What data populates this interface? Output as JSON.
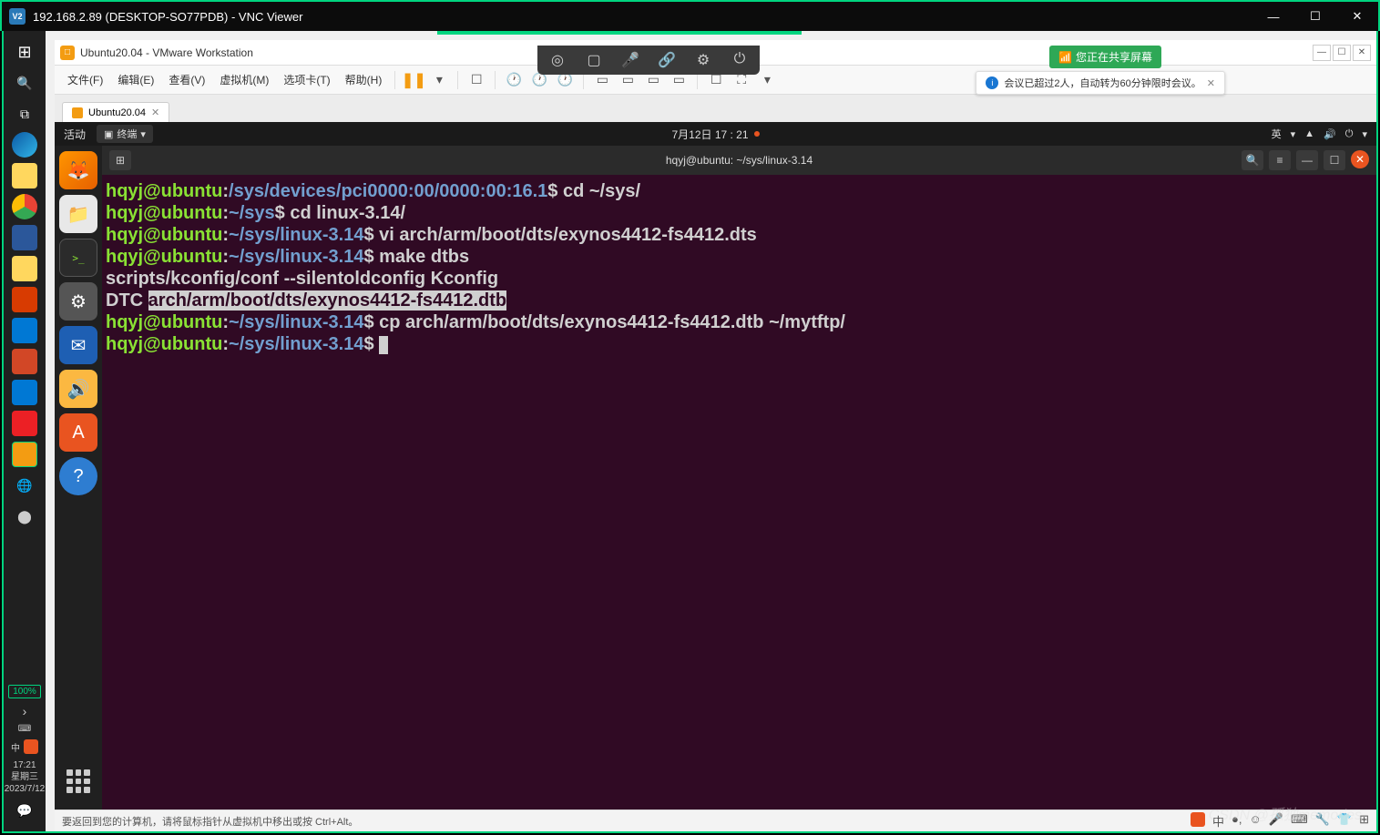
{
  "vnc": {
    "title": "192.168.2.89 (DESKTOP-SO77PDB) - VNC Viewer",
    "icon_text": "V2"
  },
  "win_taskbar": {
    "battery": "100%",
    "time": "17:21",
    "weekday": "星期三",
    "date": "2023/7/12",
    "ime_label": "中",
    "start_icon": "⊞"
  },
  "vmware": {
    "title": "Ubuntu20.04 - VMware Workstation",
    "menu": {
      "file": "文件(F)",
      "edit": "编辑(E)",
      "view": "查看(V)",
      "vm": "虚拟机(M)",
      "tabs": "选项卡(T)",
      "help": "帮助(H)"
    },
    "tab": {
      "label": "Ubuntu20.04"
    },
    "status_text": "要返回到您的计算机，请将鼠标指针从虚拟机中移出或按 Ctrl+Alt。",
    "ime_cn": "中"
  },
  "share": {
    "text": "您正在共享屏幕"
  },
  "notification": {
    "text": "会议已超过2人，自动转为60分钟限时会议。"
  },
  "ubuntu": {
    "activities": "活动",
    "app_label": "终端",
    "datetime": "7月12日  17 : 21",
    "lang": "英"
  },
  "terminal": {
    "title": "hqyj@ubuntu: ~/sys/linux-3.14",
    "lines": [
      {
        "user": "hqyj@ubuntu",
        "path": "/sys/devices/pci0000:00/0000:00:16.1",
        "cmd": "cd ~/sys/"
      },
      {
        "user": "hqyj@ubuntu",
        "path": "~/sys",
        "cmd": "cd linux-3.14/"
      },
      {
        "user": "hqyj@ubuntu",
        "path": "~/sys/linux-3.14",
        "cmd": "vi arch/arm/boot/dts/exynos4412-fs4412.dts"
      },
      {
        "user": "hqyj@ubuntu",
        "path": "~/sys/linux-3.14",
        "cmd": "make dtbs"
      }
    ],
    "output1": "scripts/kconfig/conf --silentoldconfig Kconfig",
    "dtc": "  DTC     ",
    "dtc_hl": "arch/arm/boot/dts/exynos4412-fs4412.dtb",
    "line_cp": {
      "user": "hqyj@ubuntu",
      "path": "~/sys/linux-3.14",
      "cmd": "cp arch/arm/boot/dts/exynos4412-fs4412.dtb ~/mytftp/"
    },
    "line_empty": {
      "user": "hqyj@ubuntu",
      "path": "~/sys/linux-3.14"
    }
  },
  "watermark": "CSDN @孤独memories"
}
